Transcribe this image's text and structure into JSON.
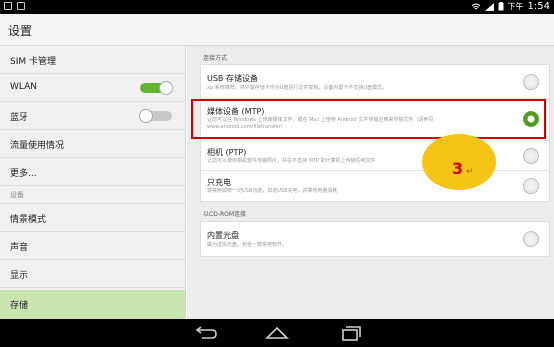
{
  "status_bar": {
    "ampm": "下午",
    "time": "1:54",
    "icons": [
      "usb-icon",
      "image-icon",
      "wifi-icon",
      "signal-icon",
      "battery-icon"
    ]
  },
  "header": {
    "title": "设置"
  },
  "sidebar": {
    "items": [
      {
        "label": "SIM 卡管理"
      },
      {
        "label": "WLAN",
        "toggle": "on"
      },
      {
        "label": "蓝牙",
        "toggle": "off"
      },
      {
        "label": "流量使用情况"
      },
      {
        "label": "更多..."
      }
    ],
    "section_label": "设备",
    "device_items": [
      {
        "label": "情景模式"
      },
      {
        "label": "声音"
      },
      {
        "label": "显示"
      },
      {
        "label": "存储",
        "active": true
      }
    ]
  },
  "main": {
    "section1_label": "连接方式",
    "options": [
      {
        "title": "USB 存储设备",
        "desc": "xp 系统推荐，将外置存储卡作为U盘进行文件复制，设备内置卡不支持U盘模式。",
        "checked": false
      },
      {
        "title": "媒体设备 (MTP)",
        "desc": "让您可以在 Windows 上传输媒体文件，或在 Mac 上使用 Android 文件传输应用来传输文件（请参见 www.android.com/filetransfer）",
        "checked": true
      },
      {
        "title": "相机 (PTP)",
        "desc": "让您可以使用相机软件传输照片，并在不支持 MTP 的计算机上传输任何文件",
        "checked": false
      },
      {
        "title": "只充电",
        "desc": "将禁用掉统一切USB功能，如进USB充电，并降低电量消耗",
        "checked": false
      }
    ],
    "section2_label": "以CD-ROM连接",
    "cdrom_option": {
      "title": "内置光盘",
      "desc": "做为虚拟光盘，包含一款常用软件。",
      "checked": false
    }
  },
  "annotation": {
    "number": "3",
    "mark": "↵"
  },
  "nav_bar": {
    "buttons": [
      "back-icon",
      "home-icon",
      "recents-icon"
    ]
  },
  "colors": {
    "accent": "#5fb22c",
    "highlight_border": "#d00000",
    "callout": "#f5c417"
  }
}
